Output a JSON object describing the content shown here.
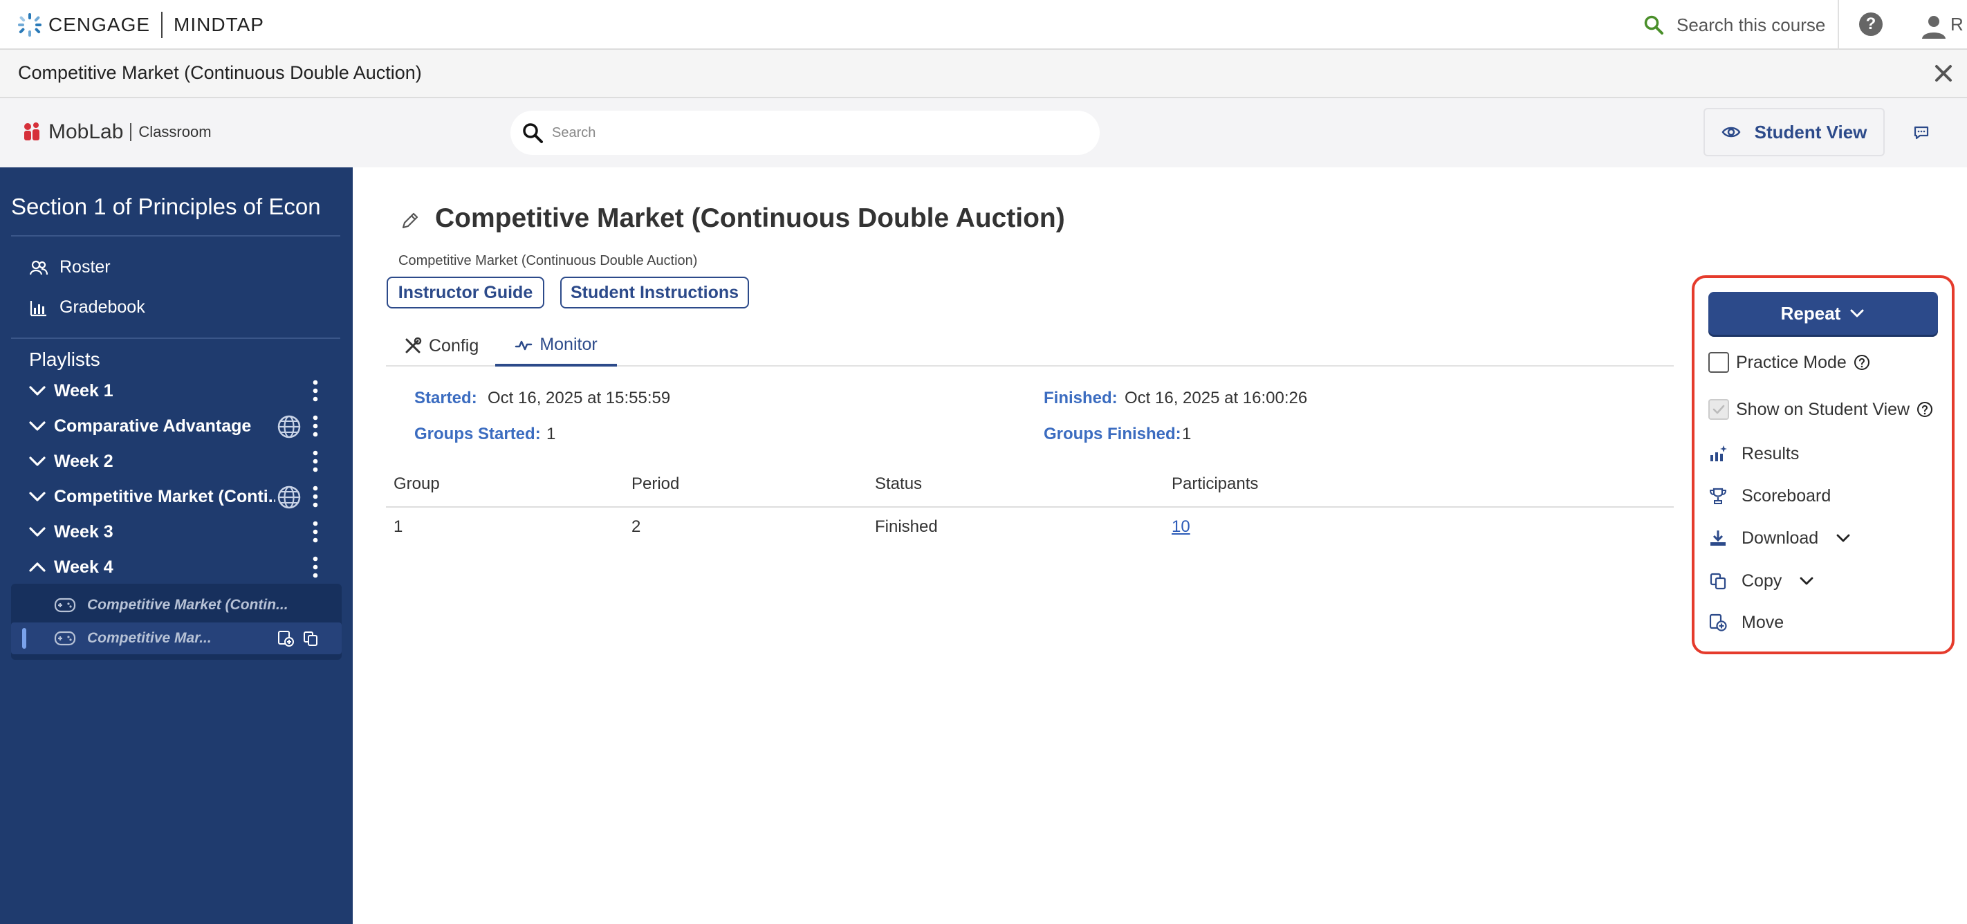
{
  "topbar": {
    "brand_left": "CENGAGE",
    "brand_right": "MINDTAP",
    "search_label": "Search this course",
    "help_label": "?",
    "user_initial": "R"
  },
  "activity_bar": {
    "title": "Competitive Market (Continuous Double Auction)"
  },
  "moblab_header": {
    "logo_name": "MobLab",
    "logo_sub": "Classroom",
    "search_placeholder": "Search",
    "student_view_label": "Student View"
  },
  "sidebar": {
    "section_title": "Section 1 of Principles of Econ",
    "links": [
      {
        "label": "Roster",
        "icon": "roster-icon"
      },
      {
        "label": "Gradebook",
        "icon": "gradebook-icon"
      }
    ],
    "playlists_heading": "Playlists",
    "playlists": [
      {
        "label": "Week 1",
        "expanded": false,
        "shared": false
      },
      {
        "label": "Comparative Advantage",
        "expanded": false,
        "shared": true
      },
      {
        "label": "Week 2",
        "expanded": false,
        "shared": false
      },
      {
        "label": "Competitive Market (Conti...",
        "expanded": false,
        "shared": true
      },
      {
        "label": "Week 3",
        "expanded": false,
        "shared": false
      },
      {
        "label": "Week 4",
        "expanded": true,
        "shared": false
      }
    ],
    "week4_items": [
      {
        "label": "Competitive Market (Contin...",
        "active": false
      },
      {
        "label": "Competitive Mar...",
        "active": true
      }
    ]
  },
  "main": {
    "title": "Competitive Market (Continuous Double Auction)",
    "subtitle": "Competitive Market (Continuous Double Auction)",
    "buttons": {
      "instructor_guide": "Instructor Guide",
      "student_instructions": "Student Instructions"
    },
    "tabs": [
      {
        "label": "Config",
        "active": false
      },
      {
        "label": "Monitor",
        "active": true
      }
    ],
    "summary": {
      "started_label": "Started:",
      "started_value": "Oct 16, 2025 at 15:55:59",
      "finished_label": "Finished:",
      "finished_value": "Oct 16, 2025 at 16:00:26",
      "groups_started_label": "Groups Started:",
      "groups_started_value": "1",
      "groups_finished_label": "Groups Finished:",
      "groups_finished_value": "1"
    },
    "table": {
      "columns": [
        "Group",
        "Period",
        "Status",
        "Participants"
      ],
      "rows": [
        [
          "1",
          "2",
          "Finished",
          "10"
        ]
      ]
    }
  },
  "action_panel": {
    "repeat_label": "Repeat",
    "practice_mode_label": "Practice Mode",
    "practice_mode_checked": false,
    "show_on_student_view_label": "Show on Student View",
    "show_on_student_view_checked": true,
    "results_label": "Results",
    "scoreboard_label": "Scoreboard",
    "download_label": "Download",
    "copy_label": "Copy",
    "move_label": "Move"
  },
  "colors": {
    "sidebar_bg": "#1f3b6e",
    "primary": "#2c4a8a",
    "accent_label": "#3b6cc0",
    "highlight_border": "#e53b2c"
  }
}
